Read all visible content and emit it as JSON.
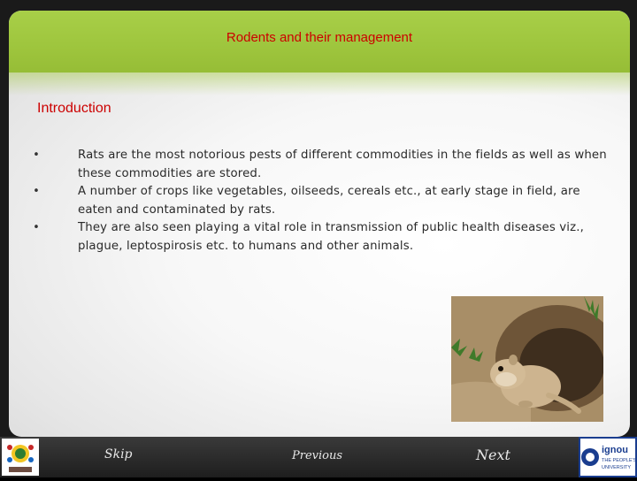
{
  "header": {
    "title": "Rodents and their  management"
  },
  "section": {
    "title": "Introduction"
  },
  "bullets": [
    {
      "symbol": "•",
      "text": "Rats are the most notorious pests of different commodities in the fields as well as when these commodities are stored."
    },
    {
      "symbol": "•",
      "text": "A number of crops like vegetables, oilseeds, cereals etc., at early stage in field, are eaten and contaminated by rats."
    },
    {
      "symbol": "•",
      "text": "They are also seen playing a vital role in transmission of public health diseases viz., plague, leptospirosis etc. to humans and other animals."
    }
  ],
  "navigation": {
    "skip": "Skip",
    "previous": "Previous",
    "next": "Next"
  },
  "logos": {
    "right_line1": "ignou",
    "right_line2": "THE PEOPLE'S",
    "right_line3": "UNIVERSITY"
  },
  "colors": {
    "header_green": "#9ec53d",
    "title_red": "#cc0000",
    "footer_dark": "#1e1e1e"
  }
}
